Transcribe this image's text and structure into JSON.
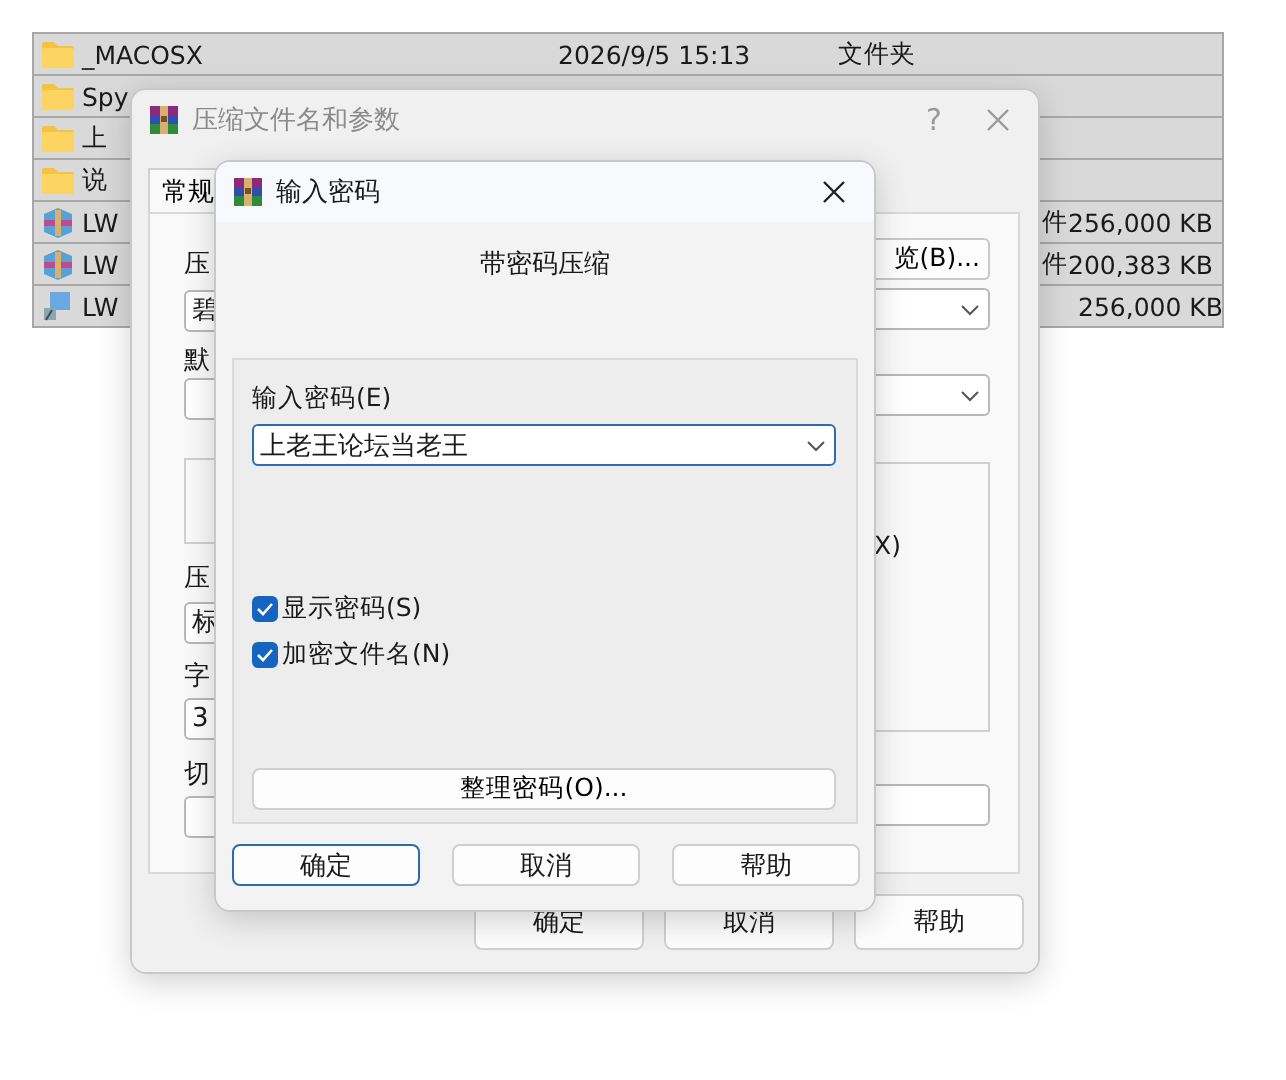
{
  "file_list": {
    "rows": [
      {
        "kind": "folder",
        "name": "_MACOSX",
        "date": "2026/9/5 15:13",
        "type": "文件夹",
        "selected": true
      },
      {
        "kind": "folder",
        "name": "Spy",
        "selected": true
      },
      {
        "kind": "folder",
        "name": "上",
        "selected": true
      },
      {
        "kind": "folder",
        "name": "说",
        "selected": true
      },
      {
        "kind": "archive",
        "name": "LW",
        "type_fragment": "件",
        "size": "256,000 KB",
        "selected": true
      },
      {
        "kind": "archive",
        "name": "LW",
        "type_fragment": "件",
        "size": "200,383 KB",
        "selected": true
      },
      {
        "kind": "volume",
        "name": "LW",
        "size": "256,000 KB",
        "selected": true
      }
    ]
  },
  "archive_dialog": {
    "title": "压缩文件名和参数",
    "help": "?",
    "tabs": [
      {
        "label": "常规",
        "selected": true
      }
    ],
    "left_fragments": [
      {
        "kind": "label",
        "text": "压"
      },
      {
        "kind": "field",
        "text": "碧"
      },
      {
        "kind": "label",
        "text": "默"
      },
      {
        "kind": "field"
      },
      {
        "kind": "group"
      },
      {
        "kind": "label",
        "text": "压"
      },
      {
        "kind": "field",
        "text": "标"
      },
      {
        "kind": "label",
        "text": "字"
      },
      {
        "kind": "field",
        "text": "3"
      },
      {
        "kind": "label",
        "text": "切"
      },
      {
        "kind": "field"
      }
    ],
    "browse_button": "览(B)...",
    "option_fragment": "X)",
    "buttons": [
      "确定",
      "取消",
      "帮助"
    ]
  },
  "password_dialog": {
    "title": "输入密码",
    "heading": "带密码压缩",
    "password_label": "输入密码(E)",
    "password_value": "上老王论坛当老王",
    "options": [
      {
        "label": "显示密码(S)",
        "checked": true
      },
      {
        "label": "加密文件名(N)",
        "checked": true
      }
    ],
    "organize_button": "整理密码(O)...",
    "buttons": [
      {
        "label": "确定",
        "default": true
      },
      {
        "label": "取消",
        "default": false
      },
      {
        "label": "帮助",
        "default": false
      }
    ]
  }
}
